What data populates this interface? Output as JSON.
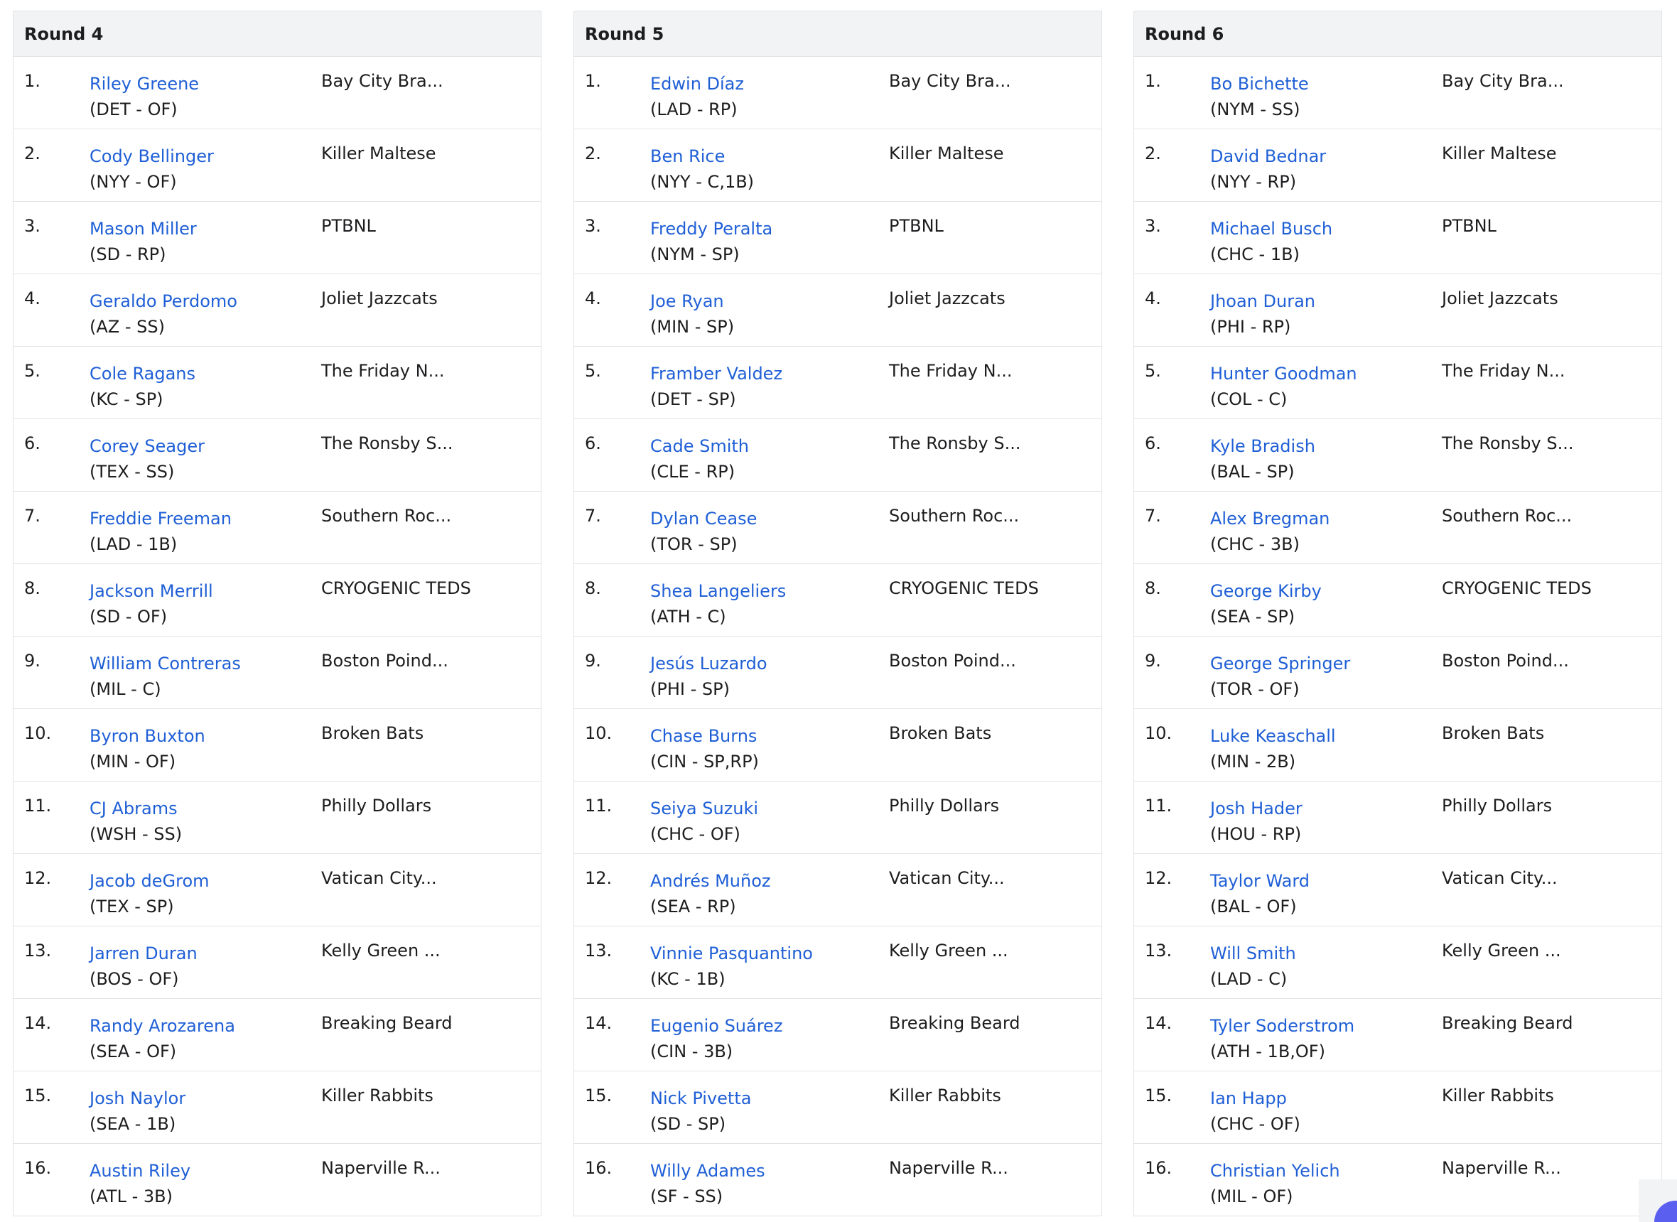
{
  "rounds": [
    {
      "title": "Round 4",
      "picks": [
        {
          "num": "1.",
          "player": "Riley Greene",
          "pos": "(DET - OF)",
          "team": "Bay City Bra..."
        },
        {
          "num": "2.",
          "player": "Cody Bellinger",
          "pos": "(NYY - OF)",
          "team": "Killer Maltese"
        },
        {
          "num": "3.",
          "player": "Mason Miller",
          "pos": "(SD - RP)",
          "team": "PTBNL"
        },
        {
          "num": "4.",
          "player": "Geraldo Perdomo",
          "pos": "(AZ - SS)",
          "team": "Joliet Jazzcats"
        },
        {
          "num": "5.",
          "player": "Cole Ragans",
          "pos": "(KC - SP)",
          "team": "The Friday N..."
        },
        {
          "num": "6.",
          "player": "Corey Seager",
          "pos": "(TEX - SS)",
          "team": "The Ronsby S..."
        },
        {
          "num": "7.",
          "player": "Freddie Freeman",
          "pos": "(LAD - 1B)",
          "team": "Southern Roc..."
        },
        {
          "num": "8.",
          "player": "Jackson Merrill",
          "pos": "(SD - OF)",
          "team": "CRYOGENIC TEDS"
        },
        {
          "num": "9.",
          "player": "William Contreras",
          "pos": "(MIL - C)",
          "team": "Boston Poind..."
        },
        {
          "num": "10.",
          "player": "Byron Buxton",
          "pos": "(MIN - OF)",
          "team": "Broken Bats"
        },
        {
          "num": "11.",
          "player": "CJ Abrams",
          "pos": "(WSH - SS)",
          "team": "Philly Dollars"
        },
        {
          "num": "12.",
          "player": "Jacob deGrom",
          "pos": "(TEX - SP)",
          "team": "Vatican City..."
        },
        {
          "num": "13.",
          "player": "Jarren Duran",
          "pos": "(BOS - OF)",
          "team": "Kelly Green ..."
        },
        {
          "num": "14.",
          "player": "Randy Arozarena",
          "pos": "(SEA - OF)",
          "team": "Breaking Beard"
        },
        {
          "num": "15.",
          "player": "Josh Naylor",
          "pos": "(SEA - 1B)",
          "team": "Killer Rabbits"
        },
        {
          "num": "16.",
          "player": "Austin Riley",
          "pos": "(ATL - 3B)",
          "team": "Naperville R..."
        }
      ]
    },
    {
      "title": "Round 5",
      "picks": [
        {
          "num": "1.",
          "player": "Edwin Díaz",
          "pos": "(LAD - RP)",
          "team": "Bay City Bra..."
        },
        {
          "num": "2.",
          "player": "Ben Rice",
          "pos": "(NYY - C,1B)",
          "team": "Killer Maltese"
        },
        {
          "num": "3.",
          "player": "Freddy Peralta",
          "pos": "(NYM - SP)",
          "team": "PTBNL"
        },
        {
          "num": "4.",
          "player": "Joe Ryan",
          "pos": "(MIN - SP)",
          "team": "Joliet Jazzcats"
        },
        {
          "num": "5.",
          "player": "Framber Valdez",
          "pos": "(DET - SP)",
          "team": "The Friday N..."
        },
        {
          "num": "6.",
          "player": "Cade Smith",
          "pos": "(CLE - RP)",
          "team": "The Ronsby S..."
        },
        {
          "num": "7.",
          "player": "Dylan Cease",
          "pos": "(TOR - SP)",
          "team": "Southern Roc..."
        },
        {
          "num": "8.",
          "player": "Shea Langeliers",
          "pos": "(ATH - C)",
          "team": "CRYOGENIC TEDS"
        },
        {
          "num": "9.",
          "player": "Jesús Luzardo",
          "pos": "(PHI - SP)",
          "team": "Boston Poind..."
        },
        {
          "num": "10.",
          "player": "Chase Burns",
          "pos": "(CIN - SP,RP)",
          "team": "Broken Bats"
        },
        {
          "num": "11.",
          "player": "Seiya Suzuki",
          "pos": "(CHC - OF)",
          "team": "Philly Dollars"
        },
        {
          "num": "12.",
          "player": "Andrés Muñoz",
          "pos": "(SEA - RP)",
          "team": "Vatican City..."
        },
        {
          "num": "13.",
          "player": "Vinnie Pasquantino",
          "pos": "(KC - 1B)",
          "team": "Kelly Green ..."
        },
        {
          "num": "14.",
          "player": "Eugenio Suárez",
          "pos": "(CIN - 3B)",
          "team": "Breaking Beard"
        },
        {
          "num": "15.",
          "player": "Nick Pivetta",
          "pos": "(SD - SP)",
          "team": "Killer Rabbits"
        },
        {
          "num": "16.",
          "player": "Willy Adames",
          "pos": "(SF - SS)",
          "team": "Naperville R..."
        }
      ]
    },
    {
      "title": "Round 6",
      "picks": [
        {
          "num": "1.",
          "player": "Bo Bichette",
          "pos": "(NYM - SS)",
          "team": "Bay City Bra..."
        },
        {
          "num": "2.",
          "player": "David Bednar",
          "pos": "(NYY - RP)",
          "team": "Killer Maltese"
        },
        {
          "num": "3.",
          "player": "Michael Busch",
          "pos": "(CHC - 1B)",
          "team": "PTBNL"
        },
        {
          "num": "4.",
          "player": "Jhoan Duran",
          "pos": "(PHI - RP)",
          "team": "Joliet Jazzcats"
        },
        {
          "num": "5.",
          "player": "Hunter Goodman",
          "pos": "(COL - C)",
          "team": "The Friday N..."
        },
        {
          "num": "6.",
          "player": "Kyle Bradish",
          "pos": "(BAL - SP)",
          "team": "The Ronsby S..."
        },
        {
          "num": "7.",
          "player": "Alex Bregman",
          "pos": "(CHC - 3B)",
          "team": "Southern Roc..."
        },
        {
          "num": "8.",
          "player": "George Kirby",
          "pos": "(SEA - SP)",
          "team": "CRYOGENIC TEDS"
        },
        {
          "num": "9.",
          "player": "George Springer",
          "pos": "(TOR - OF)",
          "team": "Boston Poind..."
        },
        {
          "num": "10.",
          "player": "Luke Keaschall",
          "pos": "(MIN - 2B)",
          "team": "Broken Bats"
        },
        {
          "num": "11.",
          "player": "Josh Hader",
          "pos": "(HOU - RP)",
          "team": "Philly Dollars"
        },
        {
          "num": "12.",
          "player": "Taylor Ward",
          "pos": "(BAL - OF)",
          "team": "Vatican City..."
        },
        {
          "num": "13.",
          "player": "Will Smith",
          "pos": "(LAD - C)",
          "team": "Kelly Green ..."
        },
        {
          "num": "14.",
          "player": "Tyler Soderstrom",
          "pos": "(ATH - 1B,OF)",
          "team": "Breaking Beard"
        },
        {
          "num": "15.",
          "player": "Ian Happ",
          "pos": "(CHC - OF)",
          "team": "Killer Rabbits"
        },
        {
          "num": "16.",
          "player": "Christian Yelich",
          "pos": "(MIL - OF)",
          "team": "Naperville R..."
        }
      ]
    }
  ],
  "colors": {
    "link": "#1f5fd6",
    "text": "#1d1d1f",
    "header_bg": "#f2f3f5",
    "border": "#e2e3e6",
    "fab_accent": "#5b5ff0"
  },
  "icons": {
    "corner_button": "chat-bubble-icon"
  }
}
